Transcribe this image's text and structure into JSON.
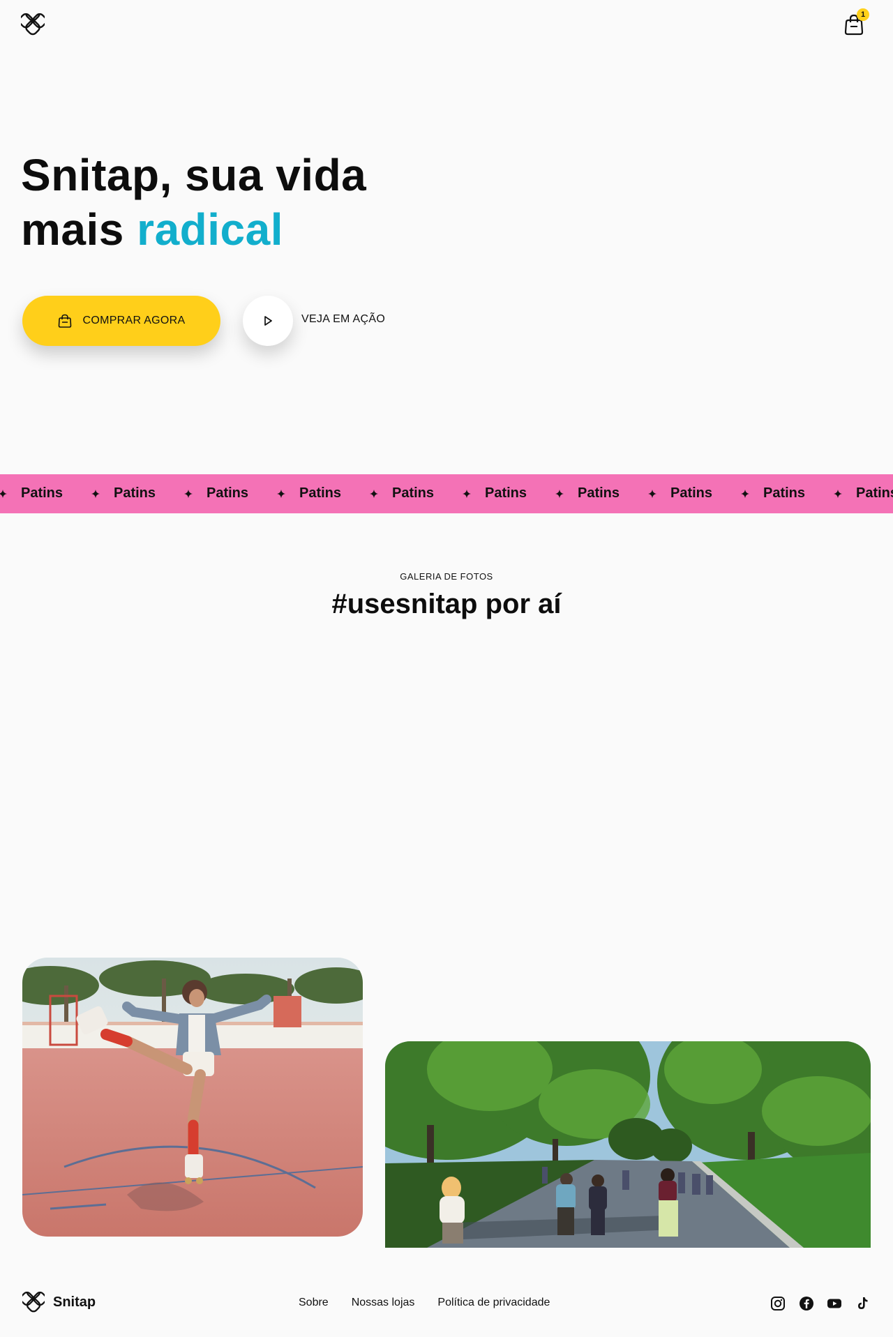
{
  "header": {
    "logo_icon": "snitap-logo-icon",
    "cart_icon": "shopping-bag-icon",
    "cart_count": "1"
  },
  "hero": {
    "title_line1": "Snitap, sua vida",
    "title_line2_prefix": "mais ",
    "title_line2_accent": "radical",
    "buy_button_label": "COMPRAR AGORA",
    "buy_button_icon": "shopping-bag-icon",
    "play_button_icon": "play-icon",
    "play_label": "VEJA EM AÇÃO"
  },
  "marquee": {
    "items": [
      "Patins",
      "Patins",
      "Patins",
      "Patins",
      "Patins",
      "Patins",
      "Patins",
      "Patins",
      "Patins",
      "Patins"
    ],
    "separator_icon": "sparkle-star-icon"
  },
  "gallery": {
    "eyebrow": "GALERIA DE FOTOS",
    "title": "#usesnitap por aí"
  },
  "footer": {
    "brand": "Snitap",
    "links": [
      "Sobre",
      "Nossas lojas",
      "Política de privacidade"
    ],
    "social_icons": [
      "instagram-icon",
      "facebook-icon",
      "youtube-icon",
      "tiktok-icon"
    ]
  },
  "colors": {
    "background": "#fafafa",
    "accent_cyan": "#12aecc",
    "button_yellow": "#ffcf1a",
    "marquee_pink": "#f472b6",
    "text": "#111111"
  }
}
